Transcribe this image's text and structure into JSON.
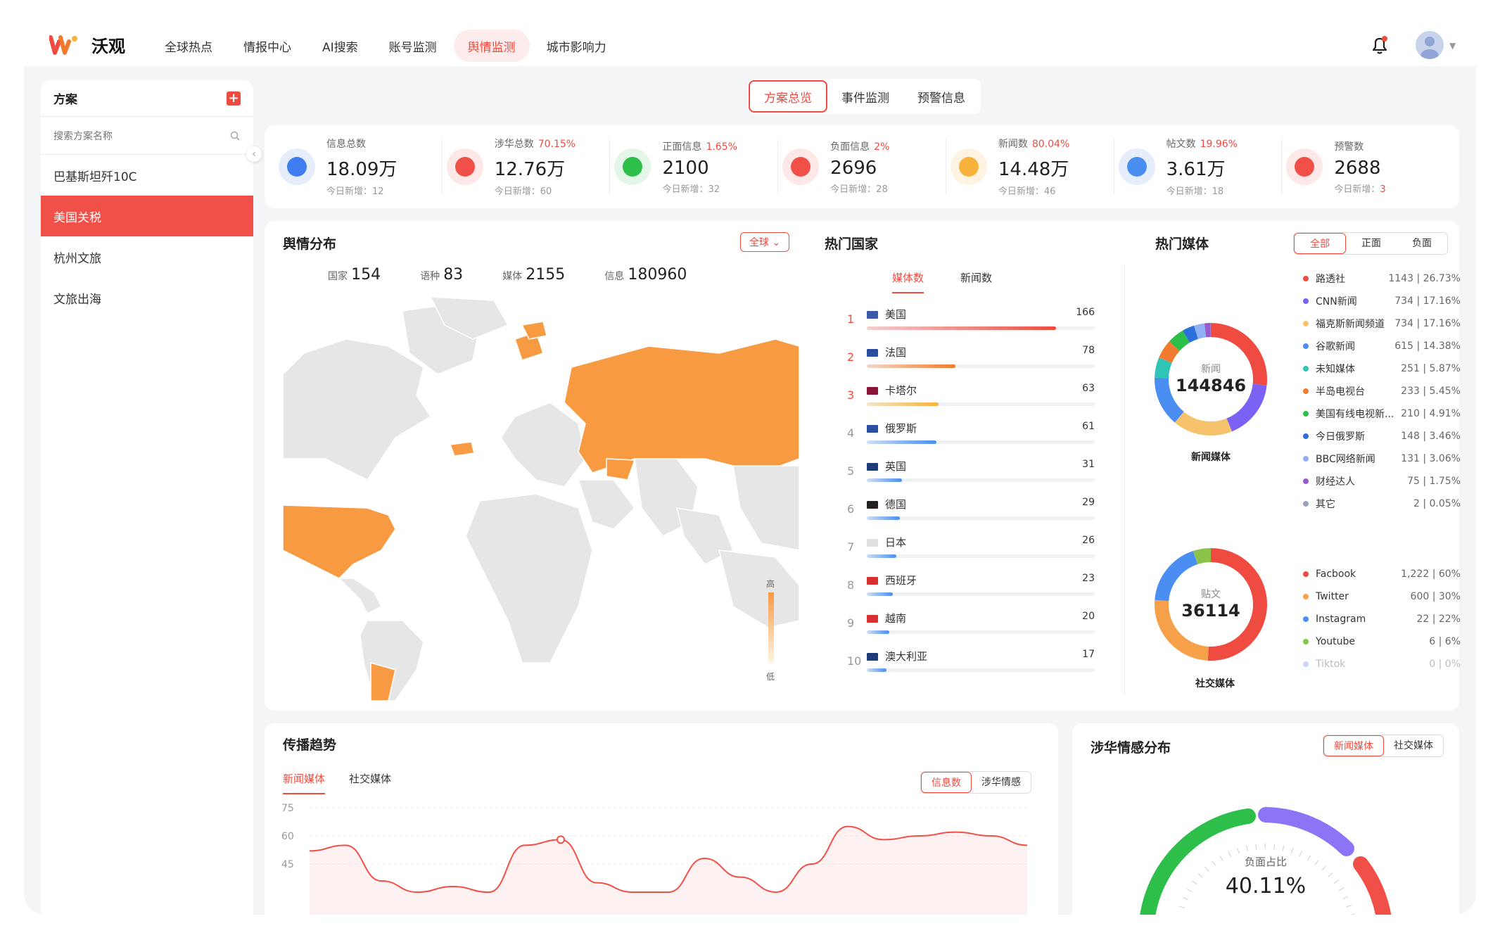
{
  "brand": {
    "name": "沃观"
  },
  "nav": [
    "全球热点",
    "情报中心",
    "AI搜索",
    "账号监测",
    "舆情监测",
    "城市影响力"
  ],
  "sidebar": {
    "title": "方案",
    "search_placeholder": "搜索方案名称",
    "items": [
      "巴基斯坦歼10C",
      "美国关税",
      "杭州文旅",
      "文旅出海"
    ]
  },
  "tabs": [
    "方案总览",
    "事件监测",
    "预警信息"
  ],
  "stats": [
    {
      "label": "信息总数",
      "pct": "",
      "value": "18.09万",
      "new_label": "今日新增：",
      "new": "12",
      "color": "#3f7ef0",
      "bg": "#e6eefc"
    },
    {
      "label": "涉华总数",
      "pct": "70.15%",
      "value": "12.76万",
      "new_label": "今日新增：",
      "new": "60",
      "color": "#f05048",
      "bg": "#fde8e7"
    },
    {
      "label": "正面信息",
      "pct": "1.65%",
      "value": "2100",
      "new_label": "今日新增：",
      "new": "32",
      "color": "#2dbf4a",
      "bg": "#e4f6e8"
    },
    {
      "label": "负面信息",
      "pct": "2%",
      "value": "2696",
      "new_label": "今日新增：",
      "new": "28",
      "color": "#f05048",
      "bg": "#fde8e7"
    },
    {
      "label": "新闻数",
      "pct": "80.04%",
      "value": "14.48万",
      "new_label": "今日新增：",
      "new": "46",
      "color": "#f6b23a",
      "bg": "#fdf3e0"
    },
    {
      "label": "帖文数",
      "pct": "19.96%",
      "value": "3.61万",
      "new_label": "今日新增：",
      "new": "18",
      "color": "#4b8ef2",
      "bg": "#e6eefc"
    },
    {
      "label": "预警数",
      "pct": "",
      "value": "2688",
      "new_label": "今日新增：",
      "new": "3",
      "color": "#f05048",
      "bg": "#fde8e7"
    }
  ],
  "distribution": {
    "title": "舆情分布",
    "scope": "全球",
    "metrics": [
      {
        "label": "国家",
        "value": "154"
      },
      {
        "label": "语种",
        "value": "83"
      },
      {
        "label": "媒体",
        "value": "2155"
      },
      {
        "label": "信息",
        "value": "180960"
      }
    ],
    "legend_high": "高",
    "legend_low": "低"
  },
  "hot_countries": {
    "title": "热门国家",
    "tabs": [
      "媒体数",
      "新闻数"
    ],
    "rows": [
      {
        "rank": "1",
        "name": "美国",
        "value": 166,
        "color": "#ef4b40",
        "flag": "#3c5aa8"
      },
      {
        "rank": "2",
        "name": "法国",
        "value": 78,
        "color": "#f27a2e",
        "flag": "#2b4fa0"
      },
      {
        "rank": "3",
        "name": "卡塔尔",
        "value": 63,
        "color": "#f6b23a",
        "flag": "#8a1538"
      },
      {
        "rank": "4",
        "name": "俄罗斯",
        "value": 61,
        "color": "#4b8ef2",
        "flag": "#2b4fa0"
      },
      {
        "rank": "5",
        "name": "英国",
        "value": 31,
        "color": "#4b8ef2",
        "flag": "#213a7a"
      },
      {
        "rank": "6",
        "name": "德国",
        "value": 29,
        "color": "#4b8ef2",
        "flag": "#222222"
      },
      {
        "rank": "7",
        "name": "日本",
        "value": 26,
        "color": "#4b8ef2",
        "flag": "#e0e0e0"
      },
      {
        "rank": "8",
        "name": "西班牙",
        "value": 23,
        "color": "#4b8ef2",
        "flag": "#d83030"
      },
      {
        "rank": "9",
        "name": "越南",
        "value": 20,
        "color": "#4b8ef2",
        "flag": "#d83030"
      },
      {
        "rank": "10",
        "name": "澳大利亚",
        "value": 17,
        "color": "#4b8ef2",
        "flag": "#1e3a7a"
      }
    ]
  },
  "hot_media": {
    "title": "热门媒体",
    "filters": [
      "全部",
      "正面",
      "负面"
    ],
    "news": {
      "label": "新闻",
      "value": "144846",
      "caption": "新闻媒体",
      "items": [
        {
          "name": "路透社",
          "stat": "1143 | 26.73%",
          "color": "#ef4b40"
        },
        {
          "name": "CNN新闻",
          "stat": "734 | 17.16%",
          "color": "#7b61f4"
        },
        {
          "name": "福克斯新闻频道",
          "stat": "734 | 17.16%",
          "color": "#f6c26b"
        },
        {
          "name": "谷歌新闻",
          "stat": "615 | 14.38%",
          "color": "#4b8ef2"
        },
        {
          "name": "未知媒体",
          "stat": "251 | 5.87%",
          "color": "#2ec4b6"
        },
        {
          "name": "半岛电视台",
          "stat": "233 | 5.45%",
          "color": "#f27a2e"
        },
        {
          "name": "美国有线电视新...",
          "stat": "210 | 4.91%",
          "color": "#2dbf4a"
        },
        {
          "name": "今日俄罗斯",
          "stat": "148 | 3.46%",
          "color": "#2b6fd8"
        },
        {
          "name": "BBC网络新闻",
          "stat": "131 | 3.06%",
          "color": "#8fb0f5"
        },
        {
          "name": "财经达人",
          "stat": "75 | 1.75%",
          "color": "#9b59d0"
        },
        {
          "name": "其它",
          "stat": "2 | 0.05%",
          "color": "#9aa3b5"
        }
      ]
    },
    "social": {
      "label": "贴文",
      "value": "36114",
      "caption": "社交媒体",
      "items": [
        {
          "name": "Facbook",
          "stat": "1,222 | 60%",
          "color": "#ef4b40"
        },
        {
          "name": "Twitter",
          "stat": "600 | 30%",
          "color": "#f6a04a"
        },
        {
          "name": "Instagram",
          "stat": "22 | 22%",
          "color": "#4b8ef2"
        },
        {
          "name": "Youtube",
          "stat": "6 | 6%",
          "color": "#8bc34a"
        },
        {
          "name": "Tiktok",
          "stat": "0 | 0%",
          "color": "#c7d7f5"
        }
      ]
    }
  },
  "trend": {
    "title": "传播趋势",
    "tabs": [
      "新闻媒体",
      "社交媒体"
    ],
    "modes": [
      "信息数",
      "涉华情感"
    ],
    "y_ticks": [
      "75",
      "60",
      "45"
    ]
  },
  "sentiment": {
    "title": "涉华情感分布",
    "tabs": [
      "新闻媒体",
      "社交媒体"
    ],
    "label": "负面占比",
    "value": "40.11%"
  },
  "chart_data": {
    "type": "area",
    "title": "传播趋势",
    "y_ticks": [
      75,
      60,
      45
    ],
    "ylim": [
      30,
      75
    ],
    "series": [
      {
        "name": "新闻媒体",
        "values": [
          52,
          55,
          36,
          30,
          33,
          30,
          55,
          58,
          35,
          30,
          30,
          48,
          38,
          30,
          45,
          65,
          58,
          60,
          62,
          60,
          55
        ]
      }
    ]
  }
}
